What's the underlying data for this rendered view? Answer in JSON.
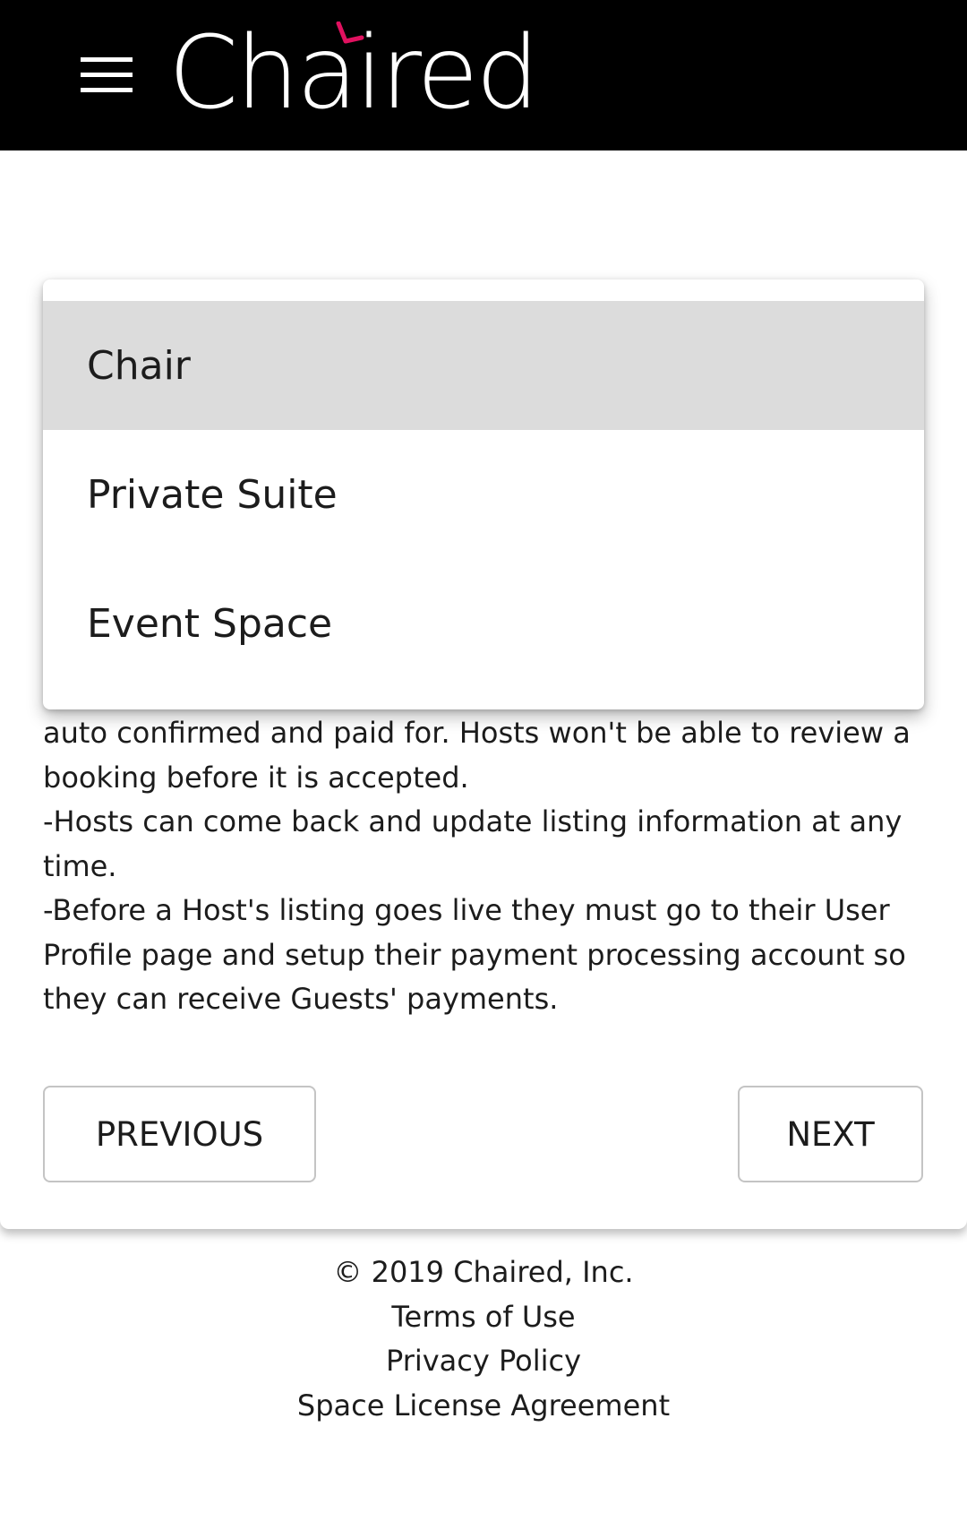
{
  "header": {
    "logo_text": "Chaired",
    "accent_color": "#e0115f"
  },
  "dropdown": {
    "options": [
      {
        "label": "Chair",
        "selected": true
      },
      {
        "label": "Private Suite",
        "selected": false
      },
      {
        "label": "Event Space",
        "selected": false
      }
    ]
  },
  "content": {
    "lines": [
      "auto confirmed and paid for. Hosts won't be able to review a",
      "booking before it is accepted.",
      "-Hosts can come back and update listing information at any",
      "time.",
      "-Before a Host's listing goes live they must go to their User",
      "Profile page and setup their payment processing account so",
      "they can receive Guests' payments."
    ]
  },
  "buttons": {
    "previous": "PREVIOUS",
    "next": "NEXT"
  },
  "footer": {
    "copyright": "© 2019 Chaired, Inc.",
    "terms": "Terms of Use",
    "privacy": "Privacy Policy",
    "license": "Space License Agreement"
  }
}
